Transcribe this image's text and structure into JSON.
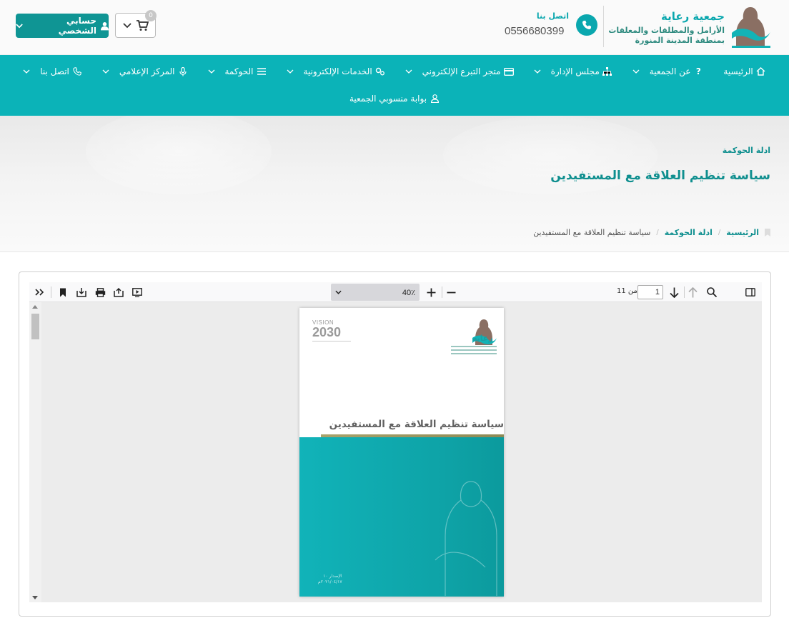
{
  "brand": {
    "title": "جمعية رعاية",
    "subtitle_line1": "الأرامل والمطلقات والمعلقات",
    "subtitle_line2": "بمنطقة المدينة المنورة",
    "color": "#0aa7ae"
  },
  "contact": {
    "label": "اتصل بنا",
    "phone": "0556680399"
  },
  "cart": {
    "count": "0"
  },
  "account": {
    "label": "حسابي الشخصي"
  },
  "nav": {
    "row1": [
      {
        "label": "الرئيسية",
        "icon": "home-icon",
        "has_dropdown": false
      },
      {
        "label": "عن الجمعية",
        "icon": "question-icon",
        "has_dropdown": true
      },
      {
        "label": "مجلس الإدارة",
        "icon": "sitemap-icon",
        "has_dropdown": true
      },
      {
        "label": "متجر التبرع الإلكتروني",
        "icon": "credit-card-icon",
        "has_dropdown": true
      },
      {
        "label": "الخدمات الإلكترونية",
        "icon": "cogs-icon",
        "has_dropdown": true
      },
      {
        "label": "الحوكمة",
        "icon": "list-icon",
        "has_dropdown": true
      },
      {
        "label": "المركز الإعلامي",
        "icon": "microphone-icon",
        "has_dropdown": true
      },
      {
        "label": "اتصل بنا",
        "icon": "phone-icon",
        "has_dropdown": true
      }
    ],
    "row2": [
      {
        "label": "بوابة منسوبي الجمعية",
        "icon": "user-icon",
        "has_dropdown": false
      }
    ]
  },
  "page": {
    "section": "ادلة الحوكمة",
    "title": "سياسة تنظيم العلاقة مع المستفيدين"
  },
  "breadcrumb": {
    "home": "الرئيسية",
    "section": "ادلة الحوكمة",
    "current": "سياسة تنظيم العلاقة مع المستفيدين"
  },
  "pdf_viewer": {
    "zoom": "40٪",
    "current_page": "1",
    "page_count_text": "من 11",
    "document": {
      "title": "سياسة تنظيم العلاقة مع المستفيدين",
      "vision_text": "VISION",
      "vision_year": "2030",
      "logo_name": "رعاية",
      "issue_line1": "الإصدار ١٠",
      "issue_line2": "٢٠٢١/٠٤/١٧م",
      "cover_color": "#11b3b9"
    }
  }
}
